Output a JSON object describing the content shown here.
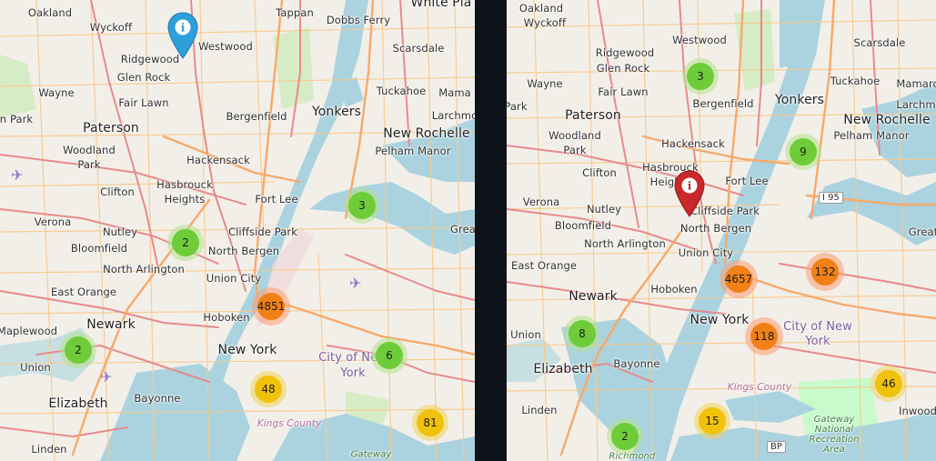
{
  "colors": {
    "land": "#f2efe9",
    "water": "#aad3df",
    "park": "#c8facc",
    "major_road": "#e88a8a",
    "motorway": "#f7a96b",
    "minor_road": "#f9c98a",
    "cluster_small": "#6ecc39",
    "cluster_medium": "#f0c20c",
    "cluster_large": "#f18017",
    "pin_left": "#2e9fd9",
    "pin_right": "#c8282a",
    "divider": "#0f141b"
  },
  "left_map": {
    "labels": [
      "Oakland",
      "Wyckoff",
      "Tappan",
      "Dobbs Ferry",
      "White Pla",
      "Westwood",
      "Ridgewood",
      "Scarsdale",
      "Glen Rock",
      "Wayne",
      "Tuckahoe",
      "Mama",
      "Fair Lawn",
      "Bergenfield",
      "Yonkers",
      "Larchmo",
      "n Park",
      "Paterson",
      "New Rochelle",
      "Woodland Park",
      "Pelham Manor",
      "Hackensack",
      "Clifton",
      "Hasbrouck Heights",
      "Fort Lee",
      "Verona",
      "Nutley",
      "Cliffside Park",
      "Bloomfield",
      "North Bergen",
      "Grea",
      "North Arlington",
      "Union City",
      "East Orange",
      "Newark",
      "Hoboken",
      "Maplewood",
      "New York",
      "City of New York",
      "Union",
      "Bayonne",
      "Elizabeth",
      "Kings County",
      "Linden",
      "Gateway"
    ],
    "clusters": [
      {
        "count": "3",
        "size": "small"
      },
      {
        "count": "2",
        "size": "small"
      },
      {
        "count": "4851",
        "size": "large"
      },
      {
        "count": "2",
        "size": "small"
      },
      {
        "count": "6",
        "size": "small"
      },
      {
        "count": "48",
        "size": "medium"
      },
      {
        "count": "81",
        "size": "medium"
      }
    ],
    "marker": {
      "icon": "info-pin-icon",
      "color": "#2e9fd9"
    }
  },
  "right_map": {
    "labels": [
      "Oakland",
      "Westwood",
      "Scarsdale",
      "Wyckoff",
      "Ridgewood",
      "Glen Rock",
      "Tuckahoe",
      "Wayne",
      "Mamaro",
      "Fair Lawn",
      "Yonkers",
      "Larchm",
      "Park",
      "Bergenfield",
      "Paterson",
      "New Rochelle",
      "Woodland Park",
      "Pelham Manor",
      "Hackensack",
      "Hasbrouck Heights",
      "Clifton",
      "Fort Lee",
      "I 95",
      "Verona",
      "Nutley",
      "Cliffside Park",
      "Bloomfield",
      "North Bergen",
      "Great",
      "North Arlington",
      "Union City",
      "East Orange",
      "Newark",
      "Hoboken",
      "New York",
      "City of New York",
      "Union",
      "Bayonne",
      "Elizabeth",
      "Kings County",
      "Linden",
      "Gateway National Recreation Area",
      "Inwood",
      "Richmond",
      "BP"
    ],
    "clusters": [
      {
        "count": "3",
        "size": "small"
      },
      {
        "count": "9",
        "size": "small"
      },
      {
        "count": "4657",
        "size": "large"
      },
      {
        "count": "132",
        "size": "large"
      },
      {
        "count": "8",
        "size": "small"
      },
      {
        "count": "118",
        "size": "large"
      },
      {
        "count": "46",
        "size": "medium"
      },
      {
        "count": "15",
        "size": "medium"
      },
      {
        "count": "2",
        "size": "small"
      }
    ],
    "marker": {
      "icon": "info-pin-icon",
      "color": "#c8282a"
    }
  }
}
